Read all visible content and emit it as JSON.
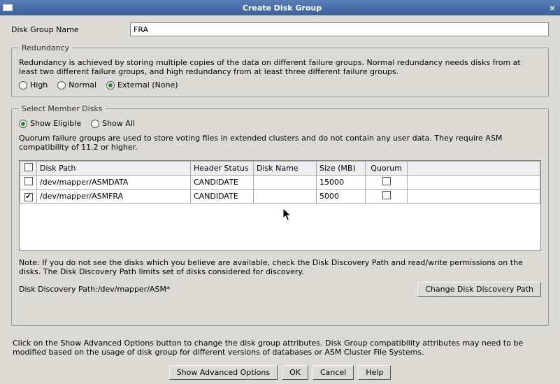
{
  "title": "Create Disk Group",
  "fields": {
    "disk_group_name_label": "Disk Group Name",
    "disk_group_name_value": "FRA"
  },
  "redundancy": {
    "legend": "Redundancy",
    "desc": "Redundancy is achieved by storing multiple copies of the data on different failure groups. Normal redundancy needs disks from at least two different failure groups, and high redundancy from at least three different failure groups.",
    "options": {
      "high": "High",
      "normal": "Normal",
      "external": "External (None)"
    },
    "selected": "external"
  },
  "member": {
    "legend": "Select Member Disks",
    "filter": {
      "eligible": "Show Eligible",
      "all": "Show All",
      "selected": "eligible"
    },
    "quorum_text": "Quorum failure groups are used to store voting files in extended clusters and do not contain any user data. They require ASM compatibility of 11.2 or higher.",
    "columns": {
      "path": "Disk Path",
      "header_status": "Header Status",
      "disk_name": "Disk Name",
      "size": "Size (MB)",
      "quorum": "Quorum"
    },
    "rows": [
      {
        "checked": false,
        "path": "/dev/mapper/ASMDATA",
        "header_status": "CANDIDATE",
        "disk_name": "",
        "size": "15000",
        "quorum": false
      },
      {
        "checked": true,
        "path": "/dev/mapper/ASMFRA",
        "header_status": "CANDIDATE",
        "disk_name": "",
        "size": "5000",
        "quorum": false
      }
    ],
    "note": "Note: If you do not see the disks which you believe are available, check the Disk Discovery Path and read/write permissions on the disks. The Disk Discovery Path limits set of disks considered for discovery.",
    "discovery_label": "Disk Discovery Path:",
    "discovery_value": "/dev/mapper/ASM*",
    "change_btn": "Change Disk Discovery Path"
  },
  "footer": {
    "text": "Click on the Show Advanced Options button to change the disk group attributes. Disk Group compatibility attributes may need to be modified based on the usage of disk group for different versions of databases or ASM Cluster File Systems.",
    "buttons": {
      "advanced": "Show Advanced Options",
      "ok": "OK",
      "cancel": "Cancel",
      "help": "Help"
    }
  }
}
